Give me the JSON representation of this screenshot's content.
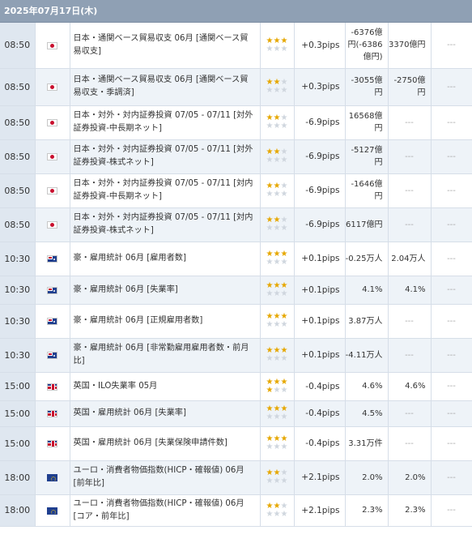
{
  "header": {
    "date": "2025年07月17日(木)"
  },
  "dash": "---",
  "star_glyph": "★",
  "colors": {
    "star_on": "#e6a700",
    "star_off": "#cfd6de",
    "header_bg": "#8fa0b4",
    "time_bg": "#dfe7f0"
  },
  "rows": [
    {
      "time": "08:50",
      "flag": "jp",
      "title": "日本・通関ベース貿易収支 06月 [通関ベース貿易収支]",
      "stars": 3,
      "pips": "+0.3pips",
      "prev": "-6376億円(-6386億円)",
      "forecast": "3370億円",
      "result": "---"
    },
    {
      "time": "08:50",
      "flag": "jp",
      "title": "日本・通関ベース貿易収支 06月 [通関ベース貿易収支・季調済]",
      "stars": 2,
      "pips": "+0.3pips",
      "prev": "-3055億円",
      "forecast": "-2750億円",
      "result": "---"
    },
    {
      "time": "08:50",
      "flag": "jp",
      "title": "日本・対外・対内証券投資 07/05 - 07/11 [対外証券投資-中長期ネット]",
      "stars": 2,
      "pips": "-6.9pips",
      "prev": "16568億円",
      "forecast": "---",
      "result": "---"
    },
    {
      "time": "08:50",
      "flag": "jp",
      "title": "日本・対外・対内証券投資 07/05 - 07/11 [対外証券投資-株式ネット]",
      "stars": 2,
      "pips": "-6.9pips",
      "prev": "-5127億円",
      "forecast": "---",
      "result": "---"
    },
    {
      "time": "08:50",
      "flag": "jp",
      "title": "日本・対外・対内証券投資 07/05 - 07/11 [対内証券投資-中長期ネット]",
      "stars": 2,
      "pips": "-6.9pips",
      "prev": "-1646億円",
      "forecast": "---",
      "result": "---"
    },
    {
      "time": "08:50",
      "flag": "jp",
      "title": "日本・対外・対内証券投資 07/05 - 07/11 [対内証券投資-株式ネット]",
      "stars": 2,
      "pips": "-6.9pips",
      "prev": "6117億円",
      "forecast": "---",
      "result": "---"
    },
    {
      "time": "10:30",
      "flag": "au",
      "title": "豪・雇用統計 06月 [雇用者数]",
      "stars": 3,
      "pips": "+0.1pips",
      "prev": "-0.25万人",
      "forecast": "2.04万人",
      "result": "---"
    },
    {
      "time": "10:30",
      "flag": "au",
      "title": "豪・雇用統計 06月 [失業率]",
      "stars": 3,
      "pips": "+0.1pips",
      "prev": "4.1%",
      "forecast": "4.1%",
      "result": "---"
    },
    {
      "time": "10:30",
      "flag": "au",
      "title": "豪・雇用統計 06月 [正規雇用者数]",
      "stars": 3,
      "pips": "+0.1pips",
      "prev": "3.87万人",
      "forecast": "---",
      "result": "---"
    },
    {
      "time": "10:30",
      "flag": "au",
      "title": "豪・雇用統計 06月 [非常勤雇用雇用者数・前月比]",
      "stars": 3,
      "pips": "+0.1pips",
      "prev": "-4.11万人",
      "forecast": "---",
      "result": "---"
    },
    {
      "time": "15:00",
      "flag": "uk",
      "title": "英国・ILO失業率 05月",
      "stars": 4,
      "pips": "-0.4pips",
      "prev": "4.6%",
      "forecast": "4.6%",
      "result": "---"
    },
    {
      "time": "15:00",
      "flag": "uk",
      "title": "英国・雇用統計 06月 [失業率]",
      "stars": 3,
      "pips": "-0.4pips",
      "prev": "4.5%",
      "forecast": "---",
      "result": "---"
    },
    {
      "time": "15:00",
      "flag": "uk",
      "title": "英国・雇用統計 06月 [失業保険申請件数]",
      "stars": 3,
      "pips": "-0.4pips",
      "prev": "3.31万件",
      "forecast": "---",
      "result": "---"
    },
    {
      "time": "18:00",
      "flag": "eu",
      "title": "ユーロ・消費者物価指数(HICP・確報値) 06月 [前年比]",
      "stars": 2,
      "pips": "+2.1pips",
      "prev": "2.0%",
      "forecast": "2.0%",
      "result": "---"
    },
    {
      "time": "18:00",
      "flag": "eu",
      "title": "ユーロ・消費者物価指数(HICP・確報値) 06月 [コア・前年比]",
      "stars": 2,
      "pips": "+2.1pips",
      "prev": "2.3%",
      "forecast": "2.3%",
      "result": "---"
    }
  ]
}
